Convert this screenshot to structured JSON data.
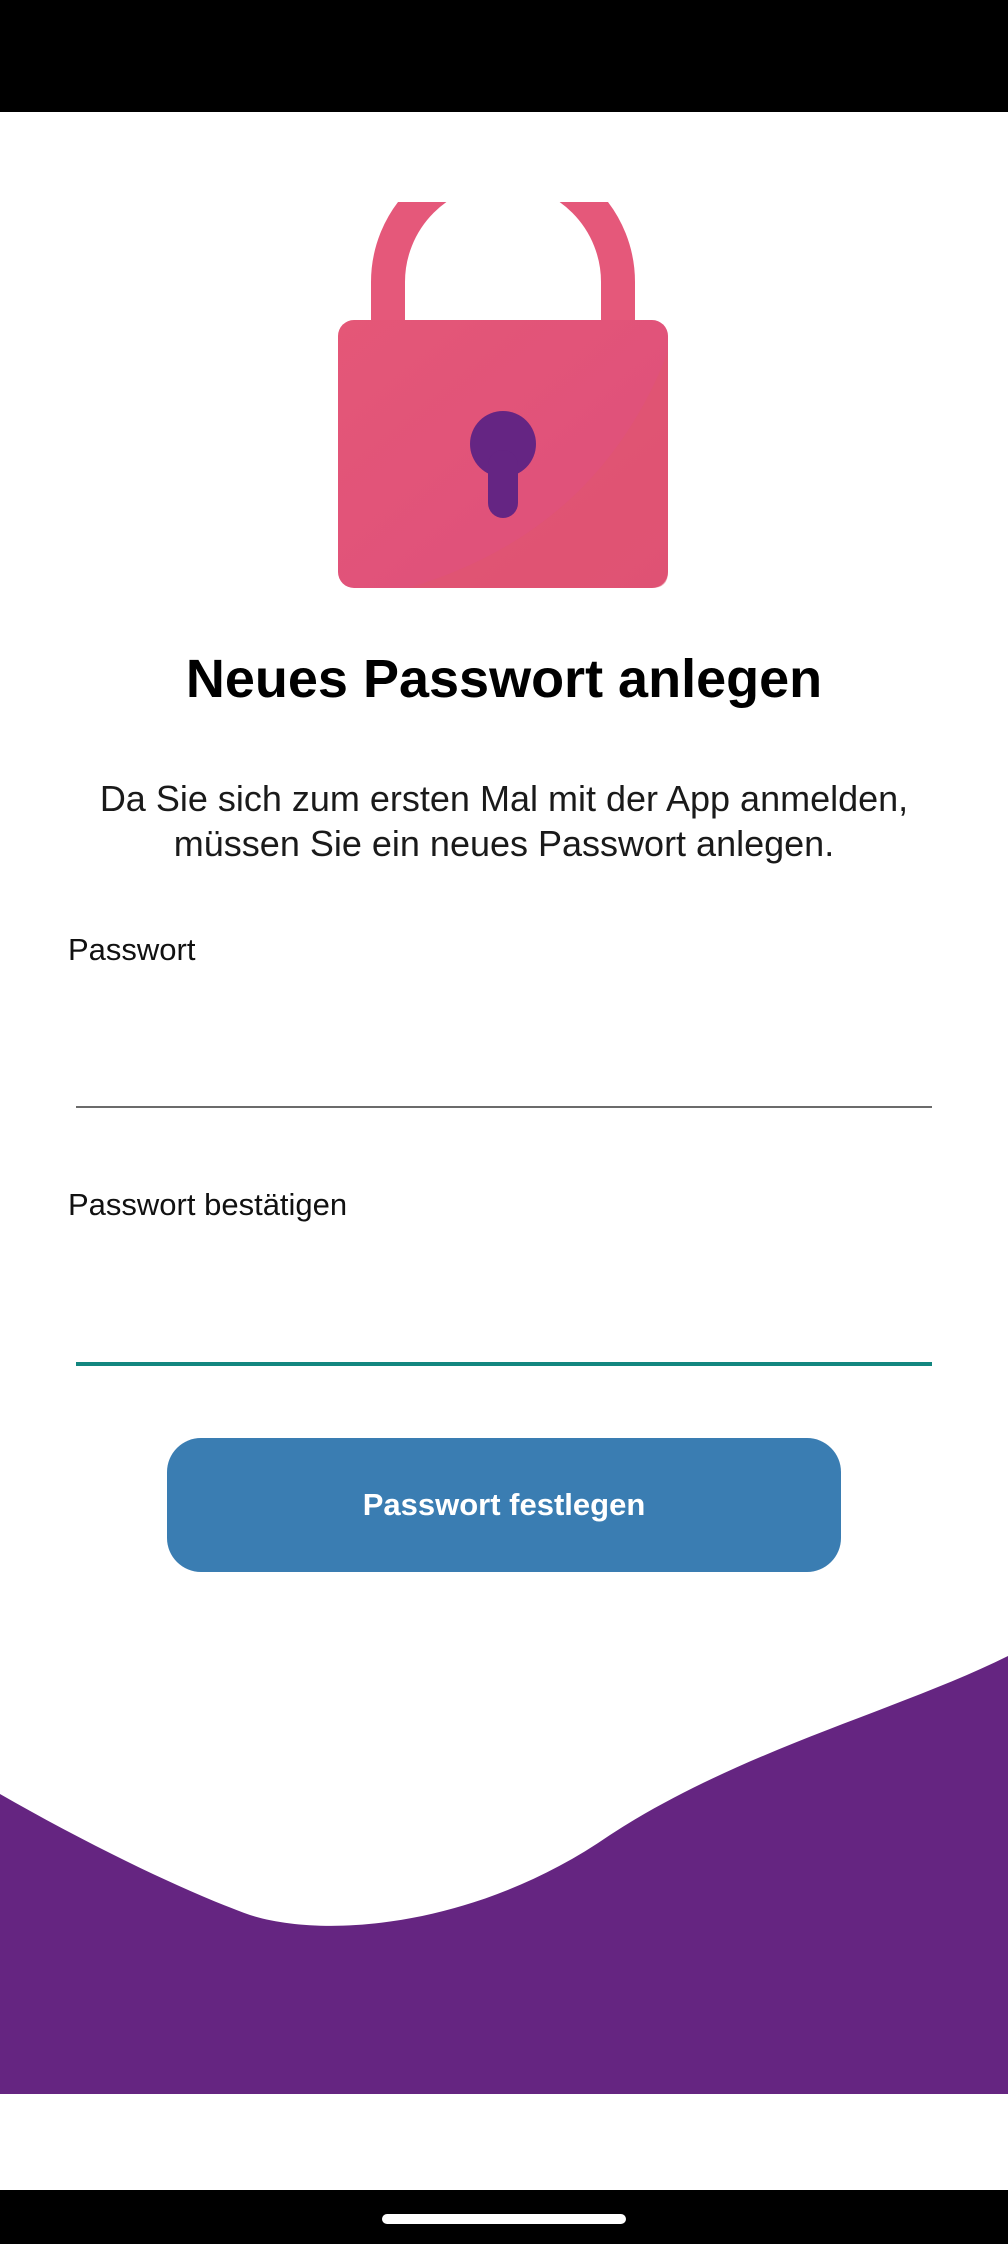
{
  "header": {
    "title": "Neues Passwort anlegen",
    "description": "Da Sie sich zum ersten Mal mit der App anmelden, müssen Sie ein neues Passwort anlegen."
  },
  "form": {
    "password": {
      "label": "Passwort",
      "value": "",
      "placeholder": ""
    },
    "confirm": {
      "label": "Passwort bestätigen",
      "value": "",
      "placeholder": ""
    },
    "submit_label": "Passwort festlegen"
  },
  "icons": {
    "hero": "lock-icon"
  },
  "colors": {
    "lock_body": "#e0527a",
    "keyhole": "#652583",
    "button": "#3a7db2",
    "wave": "#652581",
    "focused_underline": "#12867f"
  }
}
